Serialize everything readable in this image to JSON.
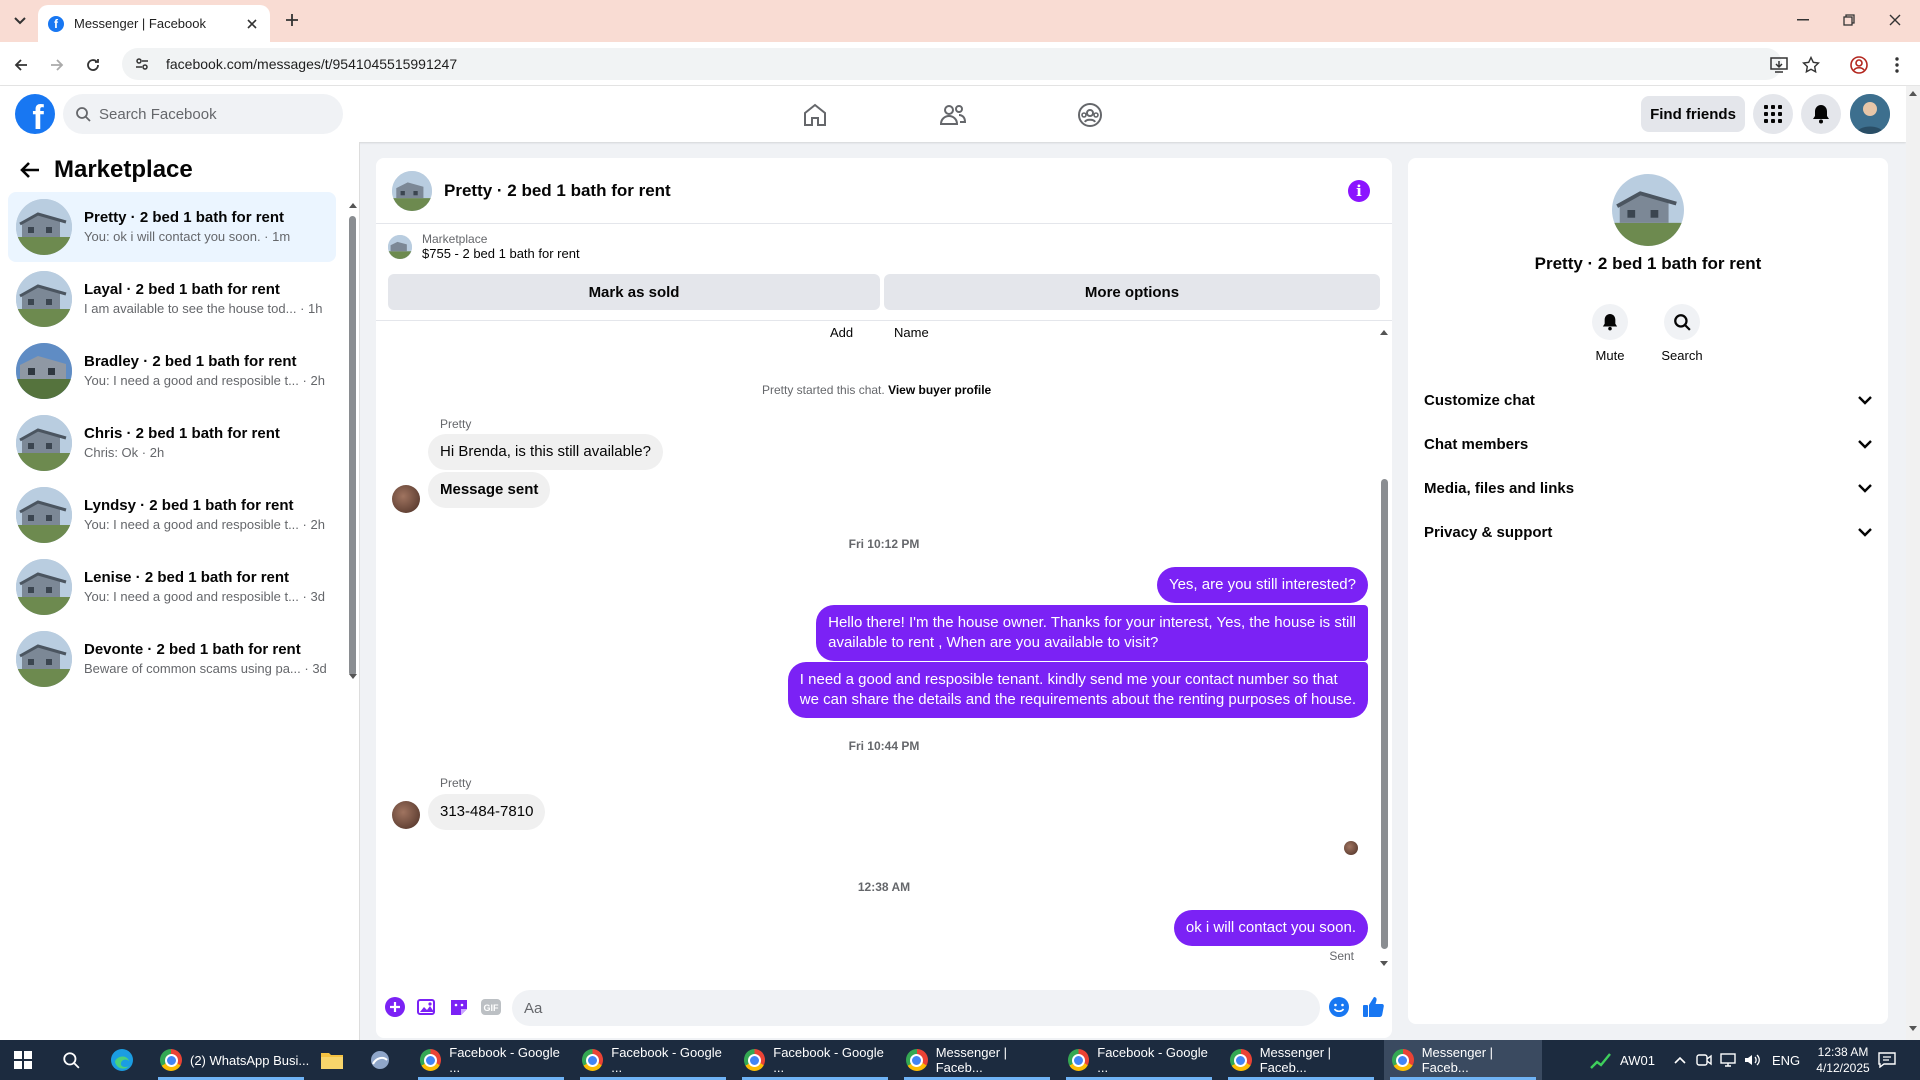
{
  "browser": {
    "tab_title": "Messenger | Facebook",
    "url": "facebook.com/messages/t/9541045515991247"
  },
  "fb": {
    "search_placeholder": "Search Facebook",
    "find_friends": "Find friends",
    "brand_color": "#1877f2"
  },
  "sidebar": {
    "title": "Marketplace",
    "conversations": [
      {
        "title": "Pretty · 2 bed 1 bath for rent",
        "snippet": "You: ok i will contact you soon. · 1m",
        "active": true
      },
      {
        "title": "Layal · 2 bed 1 bath for rent",
        "snippet": "I am available to see the house tod... · 1h"
      },
      {
        "title": "Bradley · 2 bed 1 bath for rent",
        "snippet": "You: I need a good and resposible t... · 2h"
      },
      {
        "title": "Chris · 2 bed 1 bath for rent",
        "snippet": "Chris: Ok · 2h"
      },
      {
        "title": "Lyndsy · 2 bed 1 bath for rent",
        "snippet": "You: I need a good and resposible t... · 2h"
      },
      {
        "title": "Lenise · 2 bed 1 bath for rent",
        "snippet": "You: I need a good and resposible t... · 3d"
      },
      {
        "title": "Devonte · 2 bed 1 bath for rent",
        "snippet": "Beware of common scams using pa... · 3d"
      }
    ]
  },
  "chat": {
    "title": "Pretty · 2 bed 1 bath for rent",
    "marketplace_label": "Marketplace",
    "listing": "$755 - 2 bed 1 bath for rent",
    "mark_sold": "Mark as sold",
    "more_options": "More options",
    "top_add": "Add",
    "top_name": "Name",
    "started_text": "Pretty started this chat.",
    "view_buyer": "View buyer profile",
    "sender_name": "Pretty",
    "msg1": "Hi Brenda, is this still available?",
    "msg2": "Message sent",
    "ts1": "Fri 10:12 PM",
    "out1": "Yes, are you still interested?",
    "out2_l1": "Hello there! I'm the house owner. Thanks for your interest, Yes, the house is still",
    "out2_l2": "available to rent , When are you available to visit?",
    "out3_l1": "I need a good and resposible tenant.  kindly send me your contact number so that",
    "out3_l2": "we can share the details and the requirements about the renting purposes of house.",
    "ts2": "Fri 10:44 PM",
    "msg3": "313-484-7810",
    "ts3": "12:38 AM",
    "out4": "ok i will contact you soon.",
    "sent": "Sent",
    "composer_placeholder": "Aa",
    "accent_color": "#7b22f5"
  },
  "details": {
    "name": "Pretty · 2 bed 1 bath for rent",
    "mute": "Mute",
    "search": "Search",
    "sections": [
      "Customize chat",
      "Chat members",
      "Media, files and links",
      "Privacy & support"
    ]
  },
  "taskbar": {
    "apps": [
      "(2) WhatsApp Busi...",
      "Facebook - Google ...",
      "Facebook - Google ...",
      "Facebook - Google ...",
      "Messenger | Faceb...",
      "Facebook - Google ...",
      "Messenger | Faceb...",
      "Messenger | Faceb..."
    ],
    "network_label": "AW01",
    "lang": "ENG",
    "time": "12:38 AM",
    "date": "4/12/2025"
  }
}
